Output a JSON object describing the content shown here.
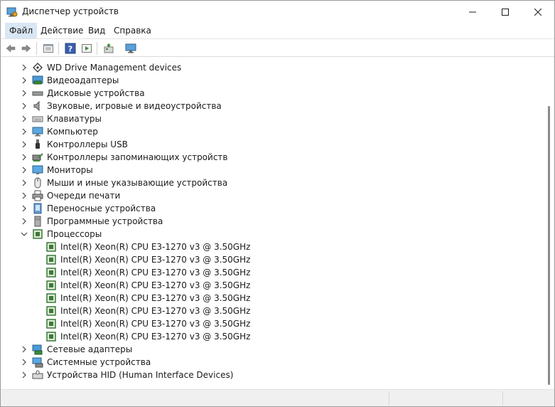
{
  "window": {
    "title": "Диспетчер устройств"
  },
  "menu": {
    "file": "Файл",
    "action": "Действие",
    "view": "Вид",
    "help": "Справка"
  },
  "toolbar": {
    "buttons": [
      "back-arrow-icon",
      "forward-arrow-icon",
      "properties-icon",
      "help-icon",
      "run-icon",
      "update-driver-icon",
      "scan-hardware-icon"
    ]
  },
  "tree": {
    "top_items_before": [
      {
        "label": "WD Drive Management devices",
        "icon": "wd-drive-icon"
      },
      {
        "label": "Видеоадаптеры",
        "icon": "display-adapter-icon"
      },
      {
        "label": "Дисковые устройства",
        "icon": "disk-drive-icon"
      },
      {
        "label": "Звуковые, игровые и видеоустройства",
        "icon": "speaker-icon"
      },
      {
        "label": "Клавиатуры",
        "icon": "keyboard-icon"
      },
      {
        "label": "Компьютер",
        "icon": "computer-icon"
      },
      {
        "label": "Контроллеры USB",
        "icon": "usb-icon"
      },
      {
        "label": "Контроллеры запоминающих устройств",
        "icon": "storage-controller-icon"
      },
      {
        "label": "Мониторы",
        "icon": "monitor-icon"
      },
      {
        "label": "Мыши и иные указывающие устройства",
        "icon": "mouse-icon"
      },
      {
        "label": "Очереди печати",
        "icon": "printer-icon"
      },
      {
        "label": "Переносные устройства",
        "icon": "portable-device-icon"
      },
      {
        "label": "Программные устройства",
        "icon": "software-device-icon"
      }
    ],
    "expanded": {
      "label": "Процессоры",
      "icon": "processor-icon",
      "children": [
        "Intel(R) Xeon(R) CPU E3-1270 v3 @ 3.50GHz",
        "Intel(R) Xeon(R) CPU E3-1270 v3 @ 3.50GHz",
        "Intel(R) Xeon(R) CPU E3-1270 v3 @ 3.50GHz",
        "Intel(R) Xeon(R) CPU E3-1270 v3 @ 3.50GHz",
        "Intel(R) Xeon(R) CPU E3-1270 v3 @ 3.50GHz",
        "Intel(R) Xeon(R) CPU E3-1270 v3 @ 3.50GHz",
        "Intel(R) Xeon(R) CPU E3-1270 v3 @ 3.50GHz",
        "Intel(R) Xeon(R) CPU E3-1270 v3 @ 3.50GHz"
      ]
    },
    "top_items_after": [
      {
        "label": "Сетевые адаптеры",
        "icon": "network-adapter-icon"
      },
      {
        "label": "Системные устройства",
        "icon": "system-device-icon"
      },
      {
        "label": "Устройства HID (Human Interface Devices)",
        "icon": "hid-icon"
      }
    ]
  },
  "colors": {
    "menu_highlight": "#d9e6f4",
    "processor_green": "#3a7a3a",
    "scroll_thumb": "#8a8a8a"
  }
}
